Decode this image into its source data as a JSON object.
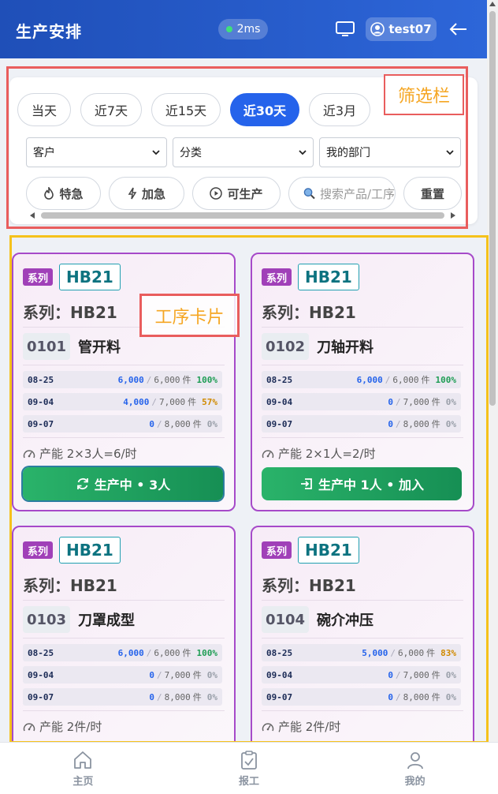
{
  "header": {
    "title": "生产安排",
    "latency": "2ms",
    "username": "test07",
    "icons": [
      "monitor-icon",
      "user-icon",
      "back-arrow-icon"
    ]
  },
  "filter": {
    "ranges": [
      {
        "label": "当天",
        "active": false
      },
      {
        "label": "近7天",
        "active": false
      },
      {
        "label": "近15天",
        "active": false
      },
      {
        "label": "近30天",
        "active": true
      },
      {
        "label": "近3月",
        "active": false
      }
    ],
    "selects": {
      "customer": "客户",
      "category": "分类",
      "department": "我的部门"
    },
    "tags": {
      "special": "特急",
      "rush": "加急",
      "producible": "可生产",
      "reset": "重置"
    },
    "search_placeholder": "搜索产品/工序"
  },
  "annotations": {
    "filter_label": "筛选栏",
    "card_label": "工序卡片"
  },
  "cards": [
    {
      "badge": "系列",
      "code": "HB21",
      "series": "系列：HB21",
      "proc_no": "0101",
      "proc_name": "管开料",
      "rows": [
        {
          "date": "08-25",
          "done": "6,000",
          "plan": "6,000",
          "unit": "件",
          "pct": "100%",
          "tone": "g"
        },
        {
          "date": "09-04",
          "done": "4,000",
          "plan": "7,000",
          "unit": "件",
          "pct": "57%",
          "tone": "o"
        },
        {
          "date": "09-07",
          "done": "0",
          "plan": "8,000",
          "unit": "件",
          "pct": "0%",
          "tone": "z"
        }
      ],
      "capacity": "产能 2×3人=6/时",
      "status": "生产中 • 3人"
    },
    {
      "badge": "系列",
      "code": "HB21",
      "series": "系列：HB21",
      "proc_no": "0102",
      "proc_name": "刀轴开料",
      "rows": [
        {
          "date": "08-25",
          "done": "6,000",
          "plan": "6,000",
          "unit": "件",
          "pct": "100%",
          "tone": "g"
        },
        {
          "date": "09-04",
          "done": "0",
          "plan": "7,000",
          "unit": "件",
          "pct": "0%",
          "tone": "z"
        },
        {
          "date": "09-07",
          "done": "0",
          "plan": "8,000",
          "unit": "件",
          "pct": "0%",
          "tone": "z"
        }
      ],
      "capacity": "产能 2×1人=2/时",
      "status": "生产中 1人 • 加入"
    },
    {
      "badge": "系列",
      "code": "HB21",
      "series": "系列：HB21",
      "proc_no": "0103",
      "proc_name": "刀罩成型",
      "rows": [
        {
          "date": "08-25",
          "done": "6,000",
          "plan": "6,000",
          "unit": "件",
          "pct": "100%",
          "tone": "g"
        },
        {
          "date": "09-04",
          "done": "0",
          "plan": "7,000",
          "unit": "件",
          "pct": "0%",
          "tone": "z"
        },
        {
          "date": "09-07",
          "done": "0",
          "plan": "8,000",
          "unit": "件",
          "pct": "0%",
          "tone": "z"
        }
      ],
      "capacity": "产能 2件/时",
      "status": ""
    },
    {
      "badge": "系列",
      "code": "HB21",
      "series": "系列：HB21",
      "proc_no": "0104",
      "proc_name": "碗介冲压",
      "rows": [
        {
          "date": "08-25",
          "done": "5,000",
          "plan": "6,000",
          "unit": "件",
          "pct": "83%",
          "tone": "o"
        },
        {
          "date": "09-04",
          "done": "0",
          "plan": "7,000",
          "unit": "件",
          "pct": "0%",
          "tone": "z"
        },
        {
          "date": "09-07",
          "done": "0",
          "plan": "8,000",
          "unit": "件",
          "pct": "0%",
          "tone": "z"
        }
      ],
      "capacity": "产能 2件/时",
      "status": ""
    }
  ],
  "nav": {
    "home": "主页",
    "report": "报工",
    "mine": "我的"
  }
}
